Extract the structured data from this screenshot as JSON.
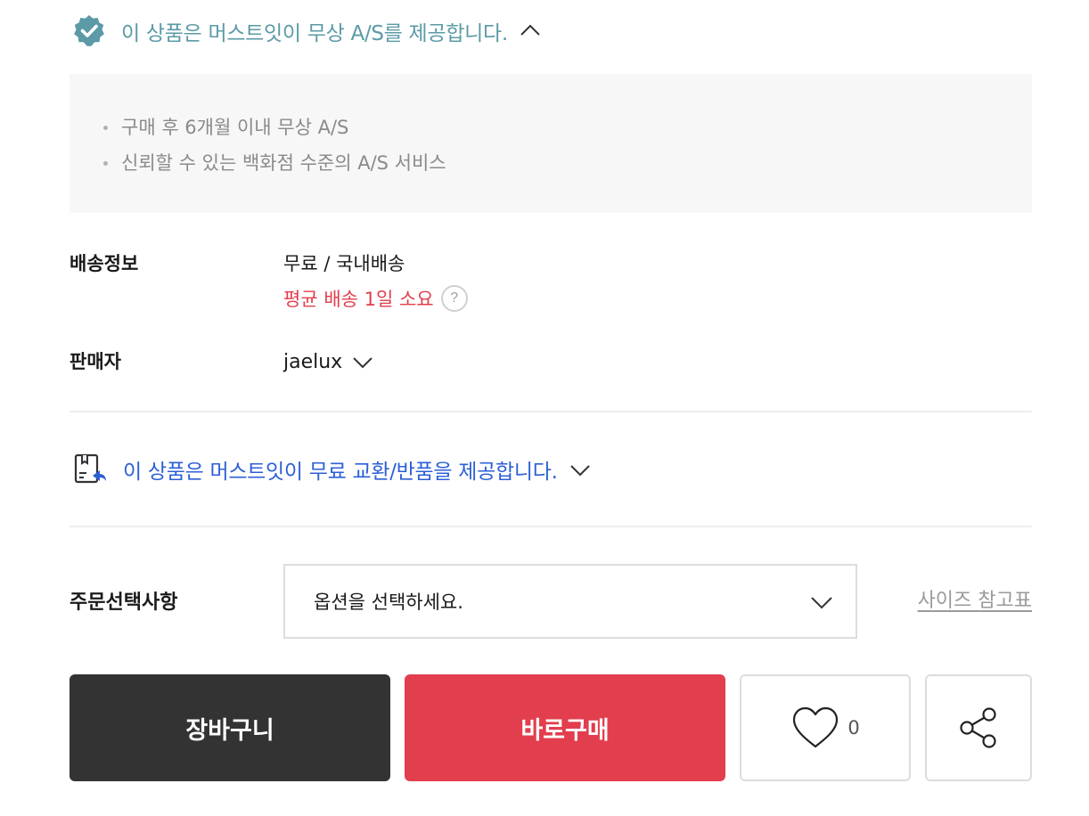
{
  "as_banner": {
    "title": "이 상품은 머스트잇이 무상 A/S를 제공합니다.",
    "icon": "verified-badge-icon",
    "toggle_icon": "chevron-up-icon",
    "color": "#5b9aa6",
    "items": [
      "구매 후 6개월 이내 무상 A/S",
      "신뢰할 수 있는 백화점 수준의 A/S 서비스"
    ]
  },
  "delivery": {
    "label": "배송정보",
    "value": "무료 / 국내배송",
    "average": "평균 배송 1일 소요",
    "help_icon": "question-circle-icon",
    "help_glyph": "?",
    "average_color": "#e03e4c"
  },
  "seller": {
    "label": "판매자",
    "name": "jaelux",
    "toggle_icon": "chevron-down-icon"
  },
  "exchange_banner": {
    "title": "이 상품은 머스트잇이 무료 교환/반품을 제공합니다.",
    "icon": "exchange-box-icon",
    "toggle_icon": "chevron-down-icon",
    "color": "#2c5fd6"
  },
  "order_option": {
    "label": "주문선택사항",
    "placeholder": "옵션을 선택하세요.",
    "toggle_icon": "chevron-down-icon",
    "size_guide_link": "사이즈 참고표"
  },
  "actions": {
    "cart_label": "장바구니",
    "buy_label": "바로구매",
    "like_count": "0",
    "like_icon": "heart-icon",
    "share_icon": "share-icon",
    "cart_color": "#333333",
    "buy_color": "#e23e4d"
  }
}
